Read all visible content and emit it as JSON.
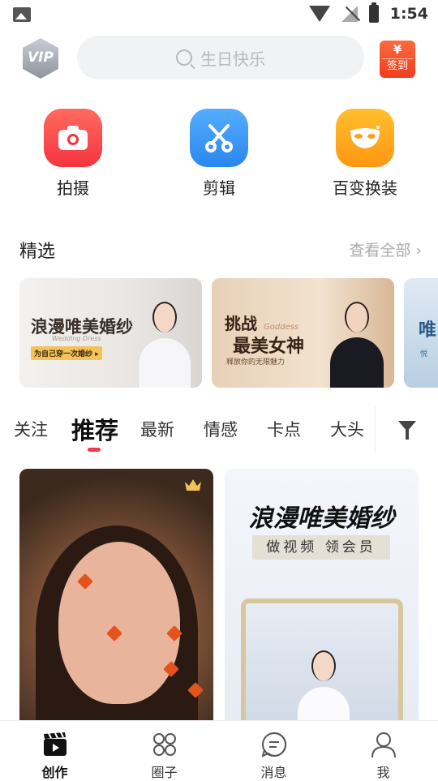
{
  "status_bar": {
    "time": "1:54",
    "icons": [
      "image-icon",
      "wifi-icon",
      "no-sim-icon",
      "battery-charging-icon"
    ]
  },
  "header": {
    "vip_label": "VIP",
    "search_placeholder": "生日快乐",
    "signin_symbol": "¥",
    "signin_label": "签到"
  },
  "tools": [
    {
      "label": "拍摄",
      "icon": "camera-icon",
      "color": "#ff4d4f"
    },
    {
      "label": "剪辑",
      "icon": "scissors-icon",
      "color": "#2e8ff5"
    },
    {
      "label": "百变换装",
      "icon": "mask-icon",
      "color": "#ffa51f"
    }
  ],
  "featured": {
    "title": "精选",
    "more_label": "查看全部",
    "banners": [
      {
        "title": "浪漫唯美婚纱",
        "subtitle": "Wedding Dress",
        "tag": "为自己穿一次婚纱 ▸"
      },
      {
        "title_top": "挑战",
        "title_main": "最美女神",
        "subtitle": "Goddess",
        "tag": "释放你的无限魅力"
      },
      {
        "title": "唯",
        "tag": "悦"
      }
    ]
  },
  "tabs": {
    "items": [
      "关注",
      "推荐",
      "最新",
      "情感",
      "卡点",
      "大头"
    ],
    "active": "推荐"
  },
  "feed": {
    "cards": [
      {
        "badge": "crown-icon"
      },
      {
        "title": "浪漫唯美婚纱",
        "subtitle": "做视频 领会员"
      }
    ]
  },
  "bottom_nav": [
    {
      "label": "创作",
      "icon": "clapperboard-icon",
      "active": true
    },
    {
      "label": "圈子",
      "icon": "grid-icon",
      "active": false
    },
    {
      "label": "消息",
      "icon": "message-icon",
      "active": false
    },
    {
      "label": "我",
      "icon": "user-icon",
      "active": false
    }
  ]
}
